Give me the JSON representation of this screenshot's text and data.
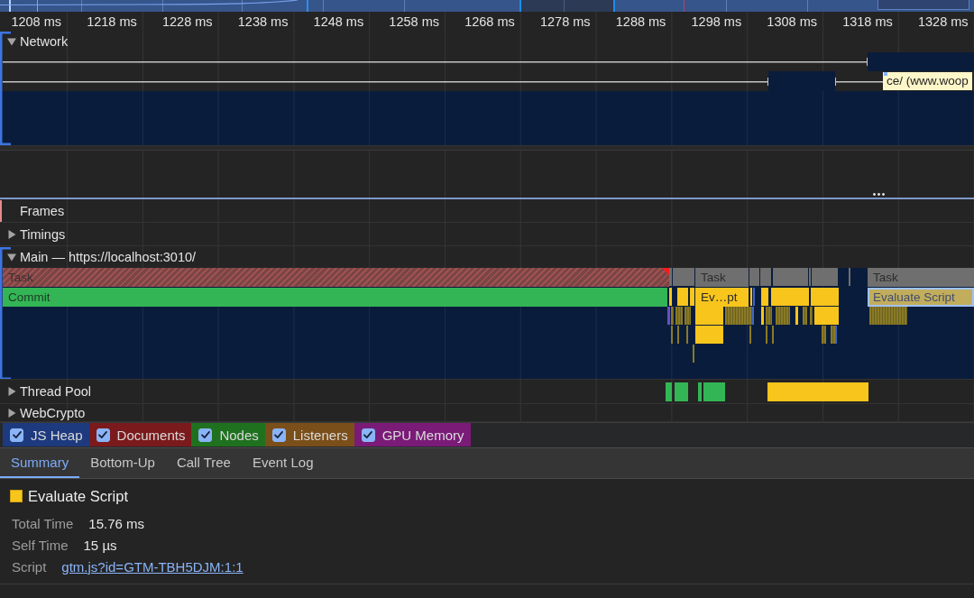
{
  "ruler": {
    "ticks": [
      "1208 ms",
      "1218 ms",
      "1228 ms",
      "1238 ms",
      "1248 ms",
      "1258 ms",
      "1268 ms",
      "1278 ms",
      "1288 ms",
      "1298 ms",
      "1308 ms",
      "1318 ms",
      "1328 ms"
    ]
  },
  "network": {
    "title": "Network",
    "expanded": true,
    "request_label": "ce/ (www.woop"
  },
  "tracks": [
    {
      "label": "Frames",
      "kind": "frames"
    },
    {
      "label": "Timings",
      "kind": "plain",
      "expanded": false
    },
    {
      "label": "Main — https://localhost:3010/",
      "kind": "flame",
      "expanded": true,
      "entries": [
        {
          "label": "Task",
          "kind": "long-task",
          "selected": false
        },
        {
          "label": "Task",
          "kind": "task",
          "selected": false
        },
        {
          "label": "Task",
          "kind": "task",
          "selected": false
        },
        {
          "label": "Commit",
          "kind": "commit",
          "selected": false
        },
        {
          "label": "Ev…pt",
          "kind": "script",
          "selected": false
        },
        {
          "label": "Evaluate Script",
          "kind": "script",
          "selected": true
        }
      ]
    },
    {
      "label": "Thread Pool",
      "kind": "pool",
      "expanded": false
    },
    {
      "label": "WebCrypto",
      "kind": "plain",
      "expanded": false
    }
  ],
  "counters": [
    {
      "label": "JS Heap",
      "checked": true,
      "color": "#1e3a7e"
    },
    {
      "label": "Documents",
      "checked": true,
      "color": "#7b1a1c"
    },
    {
      "label": "Nodes",
      "checked": true,
      "color": "#1f711f"
    },
    {
      "label": "Listeners",
      "checked": true,
      "color": "#7a4f1a"
    },
    {
      "label": "GPU Memory",
      "checked": true,
      "color": "#7a1b78"
    }
  ],
  "bottom_tabs": [
    {
      "label": "Summary",
      "selected": true
    },
    {
      "label": "Bottom-Up",
      "selected": false
    },
    {
      "label": "Call Tree",
      "selected": false
    },
    {
      "label": "Event Log",
      "selected": false
    }
  ],
  "summary": {
    "title": "Evaluate Script",
    "details": [
      {
        "label": "Total Time",
        "value": "15.76 ms",
        "kind": "text"
      },
      {
        "label": "Self Time",
        "value": "15 µs",
        "kind": "text"
      },
      {
        "label": "Script",
        "value": "gtm.js?id=GTM-TBH5DJM:1:1",
        "kind": "link"
      }
    ]
  }
}
